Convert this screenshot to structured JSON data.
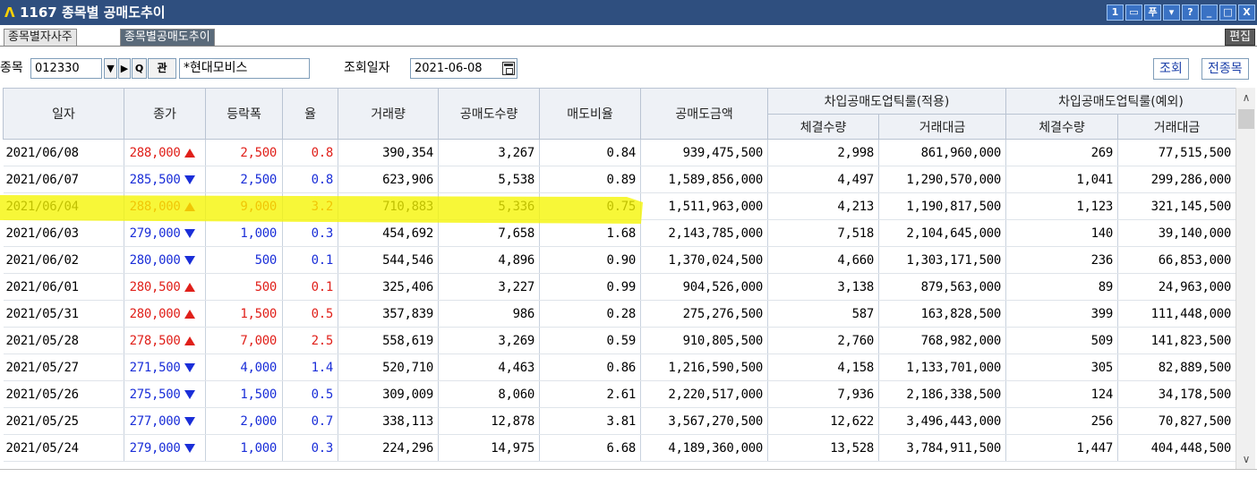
{
  "window": {
    "app_mark": "Λ",
    "title": "1167 종목별 공매도추이",
    "buttons": [
      "1",
      "▭",
      "푸",
      "▾",
      "?",
      "_",
      "□",
      "X"
    ]
  },
  "tabs": [
    {
      "label": "종목별자사주",
      "active": false
    },
    {
      "label": "종목별공매도추이",
      "active": true
    }
  ],
  "edit_label": "편집",
  "controls": {
    "stock_label": "종목",
    "stock_code": "012330",
    "name": "*현대모비스",
    "date_label": "조회일자",
    "date": "2021-06-08",
    "search_button": "조회",
    "all_stocks_button": "전종목",
    "search_icon_glyph": "Q",
    "watch_glyph": "관"
  },
  "table": {
    "headers": {
      "date": "일자",
      "close": "종가",
      "change": "등락폭",
      "rate": "율",
      "volume": "거래량",
      "short_qty": "공매도수량",
      "short_ratio": "매도비율",
      "short_amount": "공매도금액",
      "group_applied": "차입공매도업틱룰(적용)",
      "group_exempt": "차입공매도업틱룰(예외)",
      "exec_qty": "체결수량",
      "trade_amount": "거래대금"
    },
    "rows": [
      {
        "date": "2021/06/08",
        "close": "288,000",
        "dir": "up",
        "change": "2,500",
        "rate": "0.8",
        "volume": "390,354",
        "short_qty": "3,267",
        "ratio": "0.84",
        "amount": "939,475,500",
        "a_qty": "2,998",
        "a_amt": "861,960,000",
        "e_qty": "269",
        "e_amt": "77,515,500"
      },
      {
        "date": "2021/06/07",
        "close": "285,500",
        "dir": "down",
        "change": "2,500",
        "rate": "0.8",
        "volume": "623,906",
        "short_qty": "5,538",
        "ratio": "0.89",
        "amount": "1,589,856,000",
        "a_qty": "4,497",
        "a_amt": "1,290,570,000",
        "e_qty": "1,041",
        "e_amt": "299,286,000"
      },
      {
        "date": "2021/06/04",
        "close": "288,000",
        "dir": "up",
        "change": "9,000",
        "rate": "3.2",
        "volume": "710,883",
        "short_qty": "5,336",
        "ratio": "0.75",
        "amount": "1,511,963,000",
        "a_qty": "4,213",
        "a_amt": "1,190,817,500",
        "e_qty": "1,123",
        "e_amt": "321,145,500"
      },
      {
        "date": "2021/06/03",
        "close": "279,000",
        "dir": "down",
        "change": "1,000",
        "rate": "0.3",
        "volume": "454,692",
        "short_qty": "7,658",
        "ratio": "1.68",
        "amount": "2,143,785,000",
        "a_qty": "7,518",
        "a_amt": "2,104,645,000",
        "e_qty": "140",
        "e_amt": "39,140,000"
      },
      {
        "date": "2021/06/02",
        "close": "280,000",
        "dir": "down",
        "change": "500",
        "rate": "0.1",
        "volume": "544,546",
        "short_qty": "4,896",
        "ratio": "0.90",
        "amount": "1,370,024,500",
        "a_qty": "4,660",
        "a_amt": "1,303,171,500",
        "e_qty": "236",
        "e_amt": "66,853,000"
      },
      {
        "date": "2021/06/01",
        "close": "280,500",
        "dir": "up",
        "change": "500",
        "rate": "0.1",
        "volume": "325,406",
        "short_qty": "3,227",
        "ratio": "0.99",
        "amount": "904,526,000",
        "a_qty": "3,138",
        "a_amt": "879,563,000",
        "e_qty": "89",
        "e_amt": "24,963,000"
      },
      {
        "date": "2021/05/31",
        "close": "280,000",
        "dir": "up",
        "change": "1,500",
        "rate": "0.5",
        "volume": "357,839",
        "short_qty": "986",
        "ratio": "0.28",
        "amount": "275,276,500",
        "a_qty": "587",
        "a_amt": "163,828,500",
        "e_qty": "399",
        "e_amt": "111,448,000"
      },
      {
        "date": "2021/05/28",
        "close": "278,500",
        "dir": "up",
        "change": "7,000",
        "rate": "2.5",
        "volume": "558,619",
        "short_qty": "3,269",
        "ratio": "0.59",
        "amount": "910,805,500",
        "a_qty": "2,760",
        "a_amt": "768,982,000",
        "e_qty": "509",
        "e_amt": "141,823,500"
      },
      {
        "date": "2021/05/27",
        "close": "271,500",
        "dir": "down",
        "change": "4,000",
        "rate": "1.4",
        "volume": "520,710",
        "short_qty": "4,463",
        "ratio": "0.86",
        "amount": "1,216,590,500",
        "a_qty": "4,158",
        "a_amt": "1,133,701,000",
        "e_qty": "305",
        "e_amt": "82,889,500"
      },
      {
        "date": "2021/05/26",
        "close": "275,500",
        "dir": "down",
        "change": "1,500",
        "rate": "0.5",
        "volume": "309,009",
        "short_qty": "8,060",
        "ratio": "2.61",
        "amount": "2,220,517,000",
        "a_qty": "7,936",
        "a_amt": "2,186,338,500",
        "e_qty": "124",
        "e_amt": "34,178,500"
      },
      {
        "date": "2021/05/25",
        "close": "277,000",
        "dir": "down",
        "change": "2,000",
        "rate": "0.7",
        "volume": "338,113",
        "short_qty": "12,878",
        "ratio": "3.81",
        "amount": "3,567,270,500",
        "a_qty": "12,622",
        "a_amt": "3,496,443,000",
        "e_qty": "256",
        "e_amt": "70,827,500"
      },
      {
        "date": "2021/05/24",
        "close": "279,000",
        "dir": "down",
        "change": "1,000",
        "rate": "0.3",
        "volume": "224,296",
        "short_qty": "14,975",
        "ratio": "6.68",
        "amount": "4,189,360,000",
        "a_qty": "13,528",
        "a_amt": "3,784,911,500",
        "e_qty": "1,447",
        "e_amt": "404,448,500"
      }
    ]
  },
  "colors": {
    "up": "#e0201a",
    "down": "#1a2ed8",
    "highlight": "#f5f500",
    "titlebar": "#2f4f7f"
  }
}
